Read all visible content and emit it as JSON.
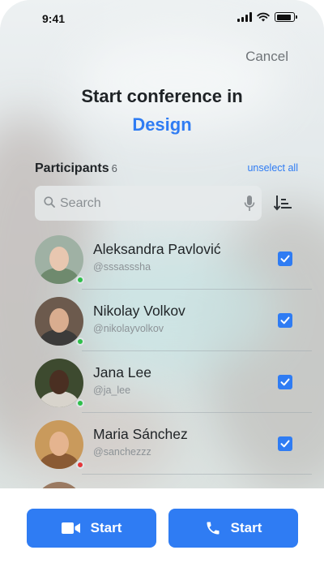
{
  "status_bar": {
    "time": "9:41",
    "battery_level": 0.85
  },
  "header": {
    "cancel_label": "Cancel",
    "title": "Start conference in",
    "group_name": "Design"
  },
  "participants": {
    "label": "Participants",
    "count": "6",
    "unselect_all_label": "unselect all"
  },
  "search": {
    "placeholder": "Search",
    "value": ""
  },
  "list": [
    {
      "name": "Aleksandra Pavlović",
      "handle": "@sssasssha",
      "status": "online",
      "selected": true
    },
    {
      "name": "Nikolay Volkov",
      "handle": "@nikolayvolkov",
      "status": "online",
      "selected": true
    },
    {
      "name": "Jana Lee",
      "handle": "@ja_lee",
      "status": "online",
      "selected": true
    },
    {
      "name": "Maria Sánchez",
      "handle": "@sanchezzz",
      "status": "offline",
      "selected": true
    }
  ],
  "colors": {
    "accent": "#2f7cf3",
    "online": "#2fbf4a",
    "offline": "#e5383b"
  },
  "actions": {
    "video_label": "Start",
    "call_label": "Start"
  }
}
